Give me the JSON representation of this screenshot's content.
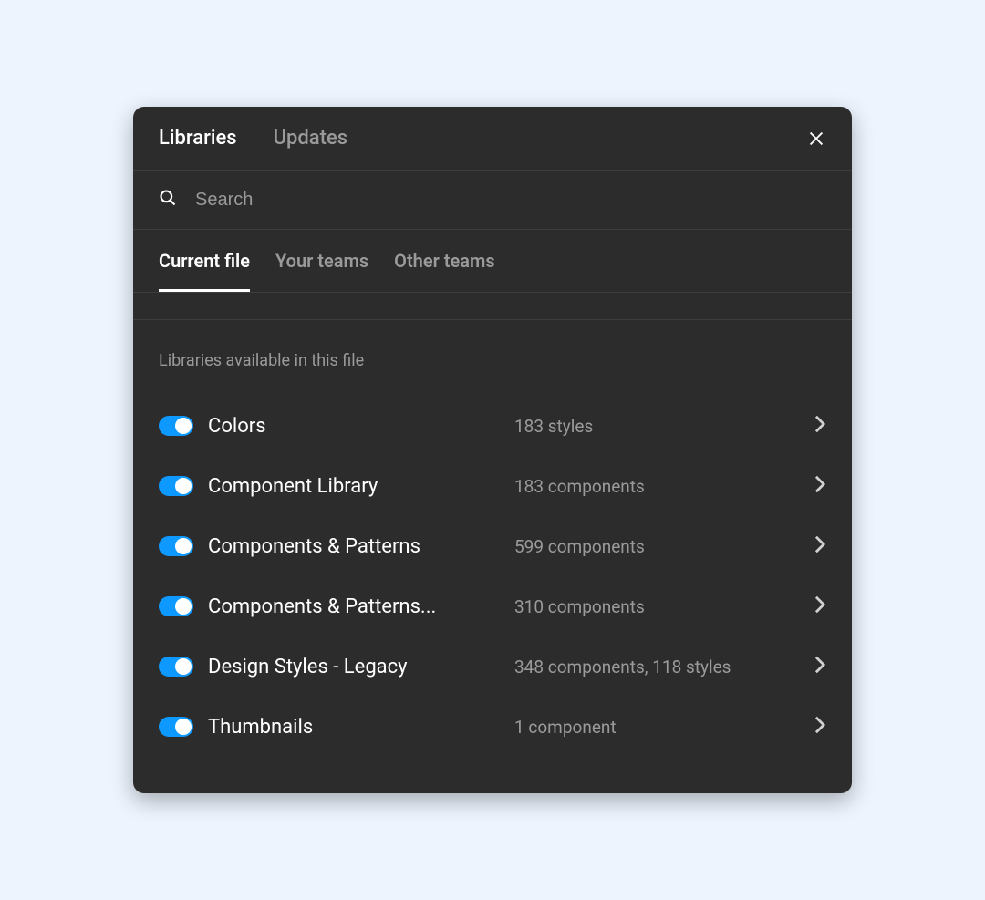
{
  "header": {
    "tabs": [
      {
        "label": "Libraries",
        "active": true
      },
      {
        "label": "Updates",
        "active": false
      }
    ]
  },
  "search": {
    "placeholder": "Search"
  },
  "sub_tabs": [
    {
      "label": "Current file",
      "active": true
    },
    {
      "label": "Your teams",
      "active": false
    },
    {
      "label": "Other teams",
      "active": false
    }
  ],
  "section_label": "Libraries available in this file",
  "libraries": [
    {
      "name": "Colors",
      "meta": "183 styles",
      "enabled": true
    },
    {
      "name": "Component Library",
      "meta": "183 components",
      "enabled": true
    },
    {
      "name": "Components & Patterns",
      "meta": "599 components",
      "enabled": true
    },
    {
      "name": "Components & Patterns...",
      "meta": "310 components",
      "enabled": true
    },
    {
      "name": "Design Styles - Legacy",
      "meta": "348 components, 118 styles",
      "enabled": true
    },
    {
      "name": "Thumbnails",
      "meta": "1 component",
      "enabled": true
    }
  ]
}
